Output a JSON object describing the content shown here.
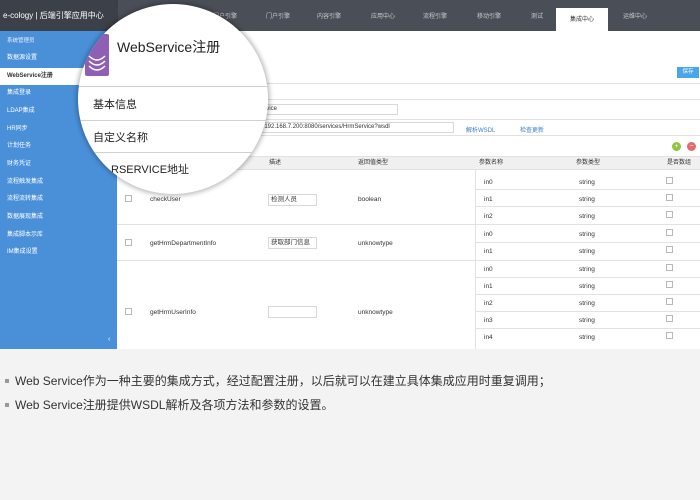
{
  "app": {
    "logo": "e-cology | 后端引擎应用中心"
  },
  "nav": {
    "items": [
      "应用",
      "门户引擎",
      "内容引擎",
      "应用中心",
      "流程引擎",
      "移动引擎",
      "测试",
      "集成中心",
      "运维中心"
    ],
    "active": "集成中心"
  },
  "sidebar": {
    "header": "系统管理员",
    "items": [
      "数据源设置",
      "WebService注册",
      "集成登录",
      "LDAP集成",
      "HR同步",
      "计划任务",
      "财务凭证",
      "流程触发集成",
      "流程流转集成",
      "数据展现集成",
      "集成脚本示库",
      "IM集成设置"
    ],
    "active": "WebService注册",
    "collapse_icon": "‹"
  },
  "toolbar": {
    "save": "保存"
  },
  "form": {
    "name_value": "ervice",
    "address_value": "//192.168.7.200:8080/services/HrmService?wsdl",
    "parse_wsdl": "解析WSDL",
    "check_update": "检查更新",
    "add_icon": "+",
    "remove_icon": "−"
  },
  "table": {
    "headers": [
      "描述",
      "返回值类型",
      "参数名称",
      "参数类型",
      "是否数组"
    ],
    "methods": [
      {
        "name": "checkUser",
        "desc": "检测人员",
        "return_type": "boolean"
      },
      {
        "name": "getHrmDepartmentInfo",
        "desc": "获取部门信息",
        "return_type": "unknowtype"
      },
      {
        "name": "getHrmUserInfo",
        "desc": "",
        "return_type": "unknowtype"
      }
    ],
    "params": [
      {
        "name": "in0",
        "type": "string"
      },
      {
        "name": "in1",
        "type": "string"
      },
      {
        "name": "in2",
        "type": "string"
      },
      {
        "name": "in0",
        "type": "string"
      },
      {
        "name": "in1",
        "type": "string"
      },
      {
        "name": "in0",
        "type": "string"
      },
      {
        "name": "in1",
        "type": "string"
      },
      {
        "name": "in2",
        "type": "string"
      },
      {
        "name": "in3",
        "type": "string"
      },
      {
        "name": "in4",
        "type": "string"
      }
    ]
  },
  "magnifier": {
    "title": "WebService注册",
    "label_basic": "基本信息",
    "label_custom_name": "自定义名称",
    "label_service_address": "RSERVICE地址"
  },
  "captions": [
    "Web Service作为一种主要的集成方式，经过配置注册，以后就可以在建立具体集成应用时重复调用；",
    "Web Service注册提供WSDL解析及各项方法和参数的设置。"
  ],
  "colors": {
    "sidebar": "#4a90d9",
    "topbar": "#4a4f57",
    "accent": "#4aa6e6",
    "icon": "#8e5fb5"
  }
}
